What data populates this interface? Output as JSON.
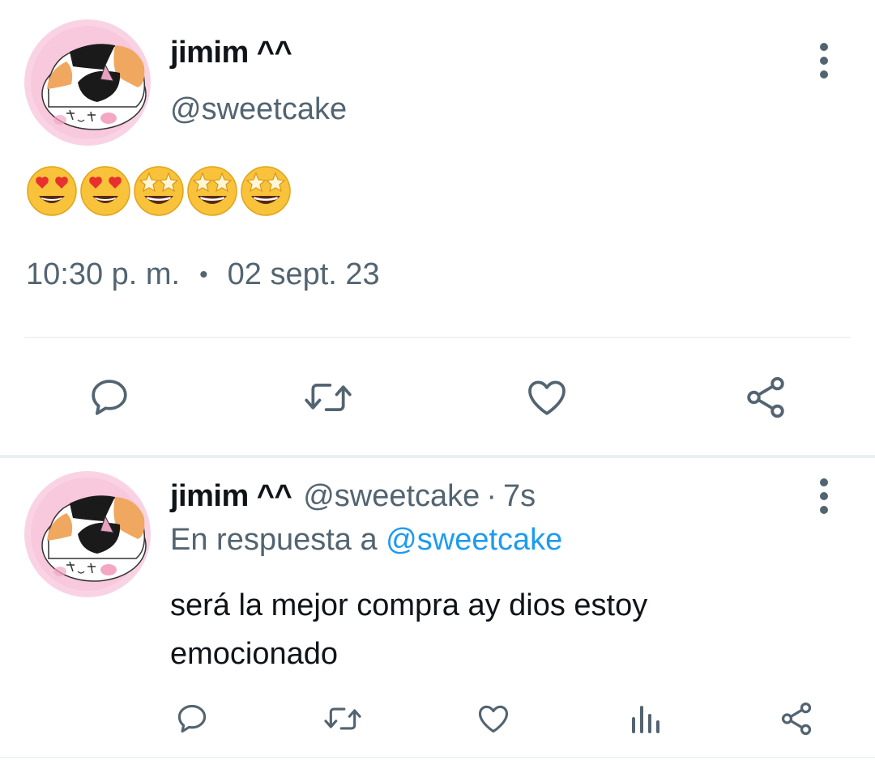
{
  "main_tweet": {
    "display_name": "jimim ^^",
    "handle": "@sweetcake",
    "emojis": [
      "heart-eyes",
      "heart-eyes",
      "star-struck",
      "star-struck",
      "star-struck"
    ],
    "time": "10:30 p. m.",
    "separator": "•",
    "date": "02 sept. 23",
    "actions": [
      "reply",
      "retweet",
      "like",
      "share"
    ]
  },
  "reply_tweet": {
    "display_name": "jimim ^^",
    "handle": "@sweetcake",
    "separator": "·",
    "time": "7s",
    "reply_to_prefix": "En respuesta a",
    "reply_to_handle": "@sweetcake",
    "text": "será la mejor compra ay dios estoy emocionado",
    "actions": [
      "reply",
      "retweet",
      "like",
      "views",
      "share"
    ]
  },
  "colors": {
    "text_primary": "#0f1419",
    "text_secondary": "#536471",
    "link": "#1d9bf0",
    "divider": "#eff3f4",
    "avatar_bg": "#f7c6dc"
  },
  "icons": [
    "avatar-cat",
    "more-vertical-icon",
    "reply-icon",
    "retweet-icon",
    "like-icon",
    "views-icon",
    "share-icon"
  ]
}
